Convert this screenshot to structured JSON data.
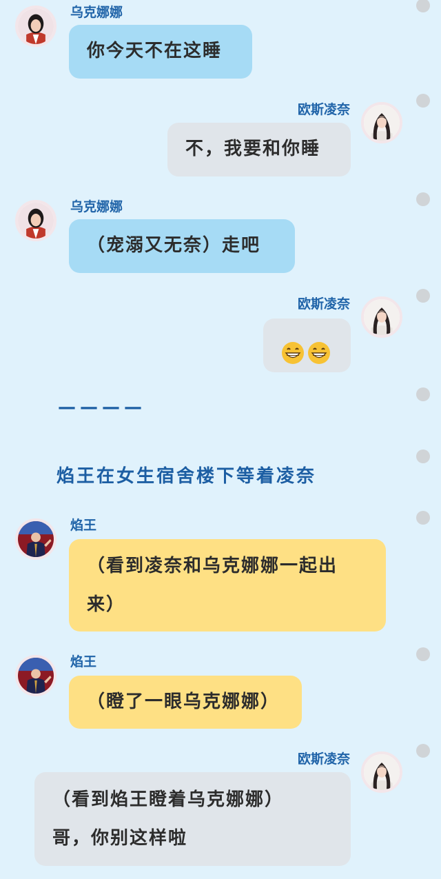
{
  "characters": {
    "ukn": "乌克娜娜",
    "ling": "欧斯凌奈",
    "yan": "焰王"
  },
  "messages": [
    {
      "speaker": "乌克娜娜",
      "lines": [
        "你今天不在这睡"
      ]
    },
    {
      "speaker": "欧斯凌奈",
      "lines": [
        "不，我要和你睡"
      ]
    },
    {
      "speaker": "乌克娜娜",
      "lines": [
        "（宠溺又无奈）走吧"
      ]
    },
    {
      "speaker": "欧斯凌奈",
      "emoji": "grinning-face-with-smiling-eyes",
      "count": 2
    },
    {
      "speaker": "焰王",
      "lines": [
        "（看到凌奈和乌克娜娜一起出",
        "来）"
      ]
    },
    {
      "speaker": "焰王",
      "lines": [
        "（瞪了一眼乌克娜娜）"
      ]
    },
    {
      "speaker": "欧斯凌奈",
      "lines": [
        "（看到焰王瞪着乌克娜娜）",
        "哥，你别这样啦"
      ]
    }
  ],
  "narration": {
    "divider": "————",
    "scene": "焰王在女生宿舍楼下等着凌奈"
  },
  "colors": {
    "background": "#e0f2fc",
    "name": "#1f63a8",
    "bubble_blue": "#a6dbf5",
    "bubble_gray": "#e0e5ea",
    "bubble_yellow": "#fee084",
    "dot": "#d0d4d7"
  }
}
